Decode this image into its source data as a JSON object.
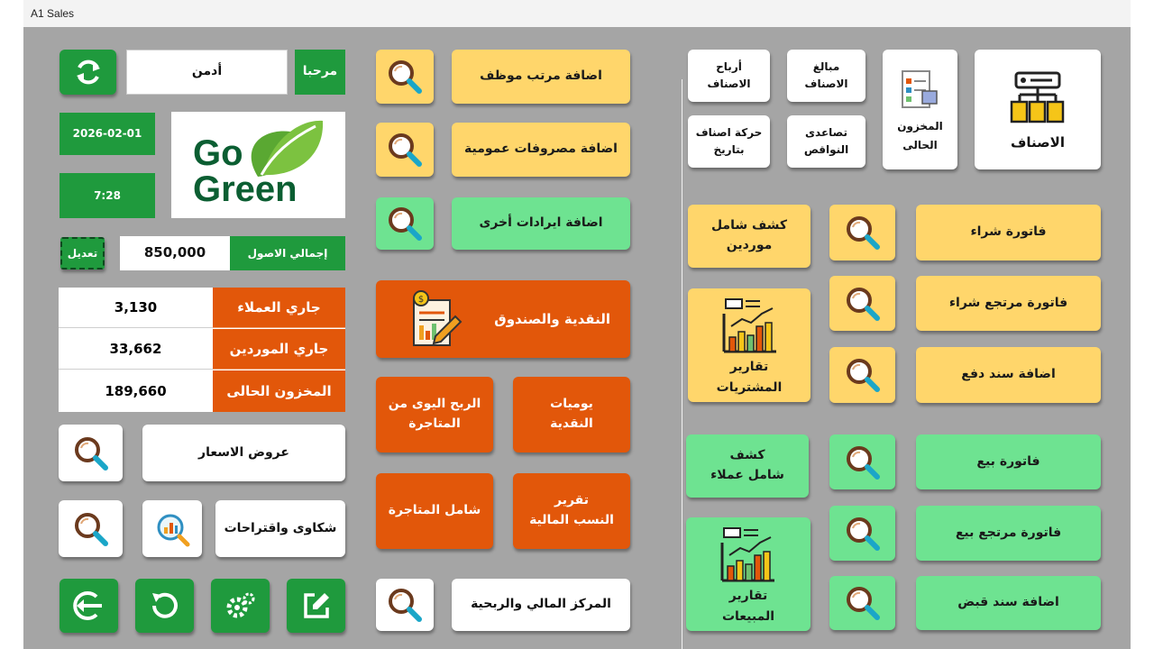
{
  "window": {
    "title": "A1 Sales"
  },
  "header": {
    "welcome_label": "مرحبا",
    "user_name": "أدمن",
    "date": "2026-02-01",
    "time": "7:28",
    "logo_line1": "Go",
    "logo_line2": "Green"
  },
  "assets": {
    "label": "إجمالي الاصول",
    "value": "850,000",
    "edit_label": "تعديل"
  },
  "summary": {
    "rows": [
      {
        "label": "جاري العملاء",
        "value": "3,130"
      },
      {
        "label": "جاري الموردين",
        "value": "33,662"
      },
      {
        "label": "المخزون الحالى",
        "value": "189,660"
      }
    ]
  },
  "left_buttons": {
    "quotes": "عروض الاسعار",
    "complaints": "شكاوى واقتراحات"
  },
  "middle": {
    "add_salary": "اضافة مرتب موظف",
    "add_expenses": "اضافة مصروفات عمومية",
    "add_revenue": "اضافة ايرادات أخرى",
    "cash_box": "النقدية والصندوق",
    "daily_cash": "يوميات\nالنقدية",
    "daily_profit": "الربح اليوى من\nالمتاجرة",
    "financial_ratios": "تقرير\nالنسب المالية",
    "trading_total": "شامل المتاجرة",
    "financial_center": "المركز المالي والربحية"
  },
  "items": {
    "items_main": "الاصناف",
    "current_stock": "المخزون\nالحالى",
    "items_amounts": "مبالغ\nالاصناف",
    "items_profits": "أرباح\nالاصناف",
    "shortages": "تصاعدى\nالنواقص",
    "items_movement": "حركة اصناف\nبتاريخ"
  },
  "purchases": {
    "purchase_invoice": "فاتورة شراء",
    "purchase_return": "فاتورة مرتجع شراء",
    "payment_voucher": "اضافة سند دفع",
    "suppliers_statement": "كشف شامل\nموردين",
    "purchases_reports": "تقارير\nالمشتريات"
  },
  "sales": {
    "sales_invoice": "فاتورة بيع",
    "sales_return": "فاتورة مرتجع بيع",
    "receipt_voucher": "اضافة سند قبض",
    "customers_statement": "كشف\nشامل عملاء",
    "sales_reports": "تقارير\nالمبيعات"
  },
  "icons": {
    "refresh": "refresh-icon",
    "search": "magnifier-icon",
    "logout": "logout-icon",
    "reload": "reload-icon",
    "settings": "gear-icon",
    "edit": "edit-icon"
  },
  "colors": {
    "background": "#a5a5a5",
    "dark_green": "#1f9a3d",
    "orange": "#e2570a",
    "yellow": "#ffd66b",
    "light_green": "#6ee391"
  }
}
